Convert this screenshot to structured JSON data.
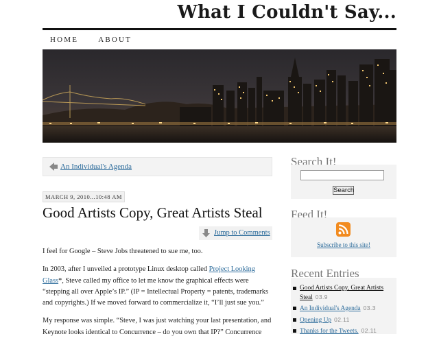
{
  "site": {
    "title": "What I Couldn't Say..."
  },
  "nav": {
    "items": [
      "HOME",
      "ABOUT"
    ]
  },
  "prev_post": {
    "label": "An Individual's Agenda"
  },
  "post": {
    "date": "MARCH 9, 2010...10:48 AM",
    "title": "Good Artists Copy, Great Artists Steal",
    "jump_label": "Jump to Comments",
    "para1": "I feel for Google – Steve Jobs threatened to sue me, too.",
    "para2_pre": "In 2003, after I unveiled a prototype Linux desktop called ",
    "para2_link": "Project Looking Glass",
    "para2_post": "*, Steve called my office to let me know the graphical effects were “stepping all over Apple’s IP.” (IP = Intellectual Property = patents, trademarks and copyrights.) If we moved forward to commercialize it, “I’ll just sue you.”",
    "para3": "My response was simple. “Steve, I was just watching your last presentation, and Keynote looks identical to Concurrence – do you own that IP?” Concurrence"
  },
  "sidebar": {
    "search": {
      "title": "Search It!",
      "button": "Search",
      "value": ""
    },
    "feed": {
      "title": "Feed It!",
      "subscribe": "Subscribe to this site!"
    },
    "recent": {
      "title": "Recent Entries",
      "items": [
        {
          "label": "Good Artists Copy, Great Artists Steal",
          "date": "03.9"
        },
        {
          "label": "An Individual's Agenda",
          "date": "03.3"
        },
        {
          "label": "Opening Up",
          "date": "02.11"
        },
        {
          "label": "Thanks for the Tweets.",
          "date": "02.11"
        }
      ]
    }
  },
  "colors": {
    "link": "#2a6a9a",
    "widget_bg": "#f3f3f3",
    "rss": "#f28b1f"
  },
  "icons": [
    "arrow-left-icon",
    "arrow-down-icon",
    "rss-icon"
  ]
}
